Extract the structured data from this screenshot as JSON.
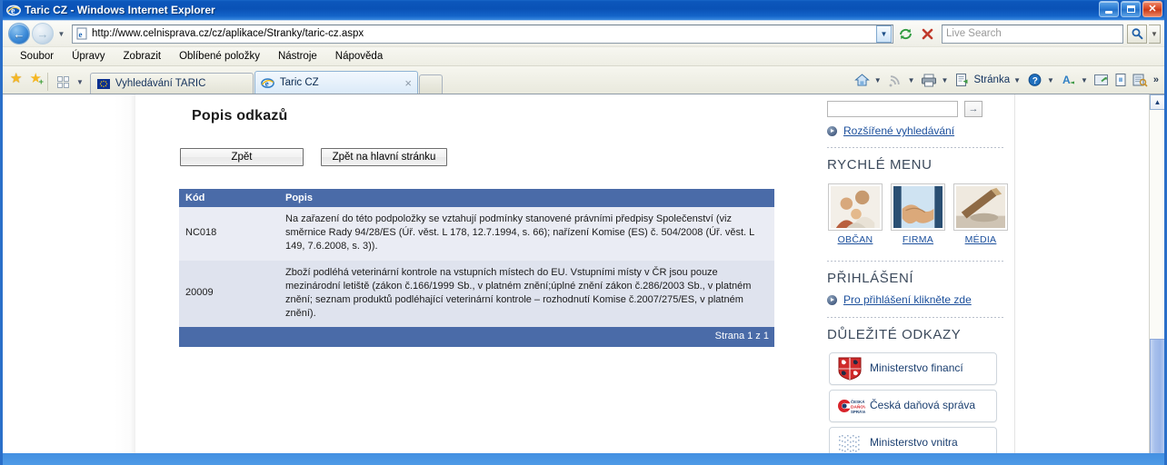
{
  "window": {
    "title": "Taric CZ - Windows Internet Explorer",
    "minimize_label": "Minimize",
    "maximize_label": "Maximize",
    "close_label": "Close"
  },
  "nav": {
    "back_label": "Back",
    "forward_label": "Forward",
    "recent_label": "Recent Pages",
    "url": "http://www.celnisprava.cz/cz/aplikace/Stranky/taric-cz.aspx",
    "url_dropdown": "Address dropdown",
    "refresh_label": "Refresh",
    "stop_label": "Stop",
    "search_placeholder": "Live Search",
    "search_go_label": "Search",
    "search_dropdown_label": "Search options"
  },
  "menubar": {
    "items": [
      {
        "label": "Soubor"
      },
      {
        "label": "Úpravy"
      },
      {
        "label": "Zobrazit"
      },
      {
        "label": "Oblíbené položky"
      },
      {
        "label": "Nástroje"
      },
      {
        "label": "Nápověda"
      }
    ]
  },
  "favbar": {
    "favorites_center_label": "Centrum oblíbených položek",
    "add_favorite_label": "Přidat k oblíbeným položkám",
    "quick_tabs_label": "Rychlé karty",
    "tab_list_label": "Seznam karet"
  },
  "tabs": [
    {
      "label": "Vyhledávání TARIC",
      "icon": "eu-flag-icon",
      "active": false,
      "closable": false
    },
    {
      "label": "Taric CZ",
      "icon": "ie-icon",
      "active": true,
      "closable": true,
      "close_label": "×"
    }
  ],
  "newtab": {
    "label": "Nová karta"
  },
  "commandbar": {
    "home_label": "Domovská stránka",
    "feeds_label": "Kanály",
    "print_label": "Tisk",
    "page_label": "Stránka",
    "help_label": "Nápověda",
    "safety_label": "Zabezpečení",
    "tools_label": "Nástroje",
    "readmail_label": "Číst poštu",
    "research_label": "Výzkum",
    "overflow_label": "»"
  },
  "main": {
    "page_title": "Popis odkazů",
    "buttons": {
      "back": "Zpět",
      "home": "Zpět na hlavní stránku"
    },
    "table": {
      "columns": [
        "Kód",
        "Popis"
      ],
      "rows": [
        {
          "kod": "NC018",
          "popis": "Na zařazení do této podpoložky se vztahují podmínky stanovené právními předpisy Společenství (viz směrnice Rady 94/28/ES (Úř. věst. L 178, 12.7.1994, s. 66); nařízení Komise (ES) č. 504/2008 (Úř. věst. L 149, 7.6.2008, s. 3))."
        },
        {
          "kod": "20009",
          "popis": "Zboží podléhá veterinární kontrole na vstupních místech do EU. Vstupními místy v ČR jsou pouze mezinárodní letiště (zákon č.166/1999 Sb., v platném znění;úplné znění zákon č.286/2003 Sb., v platném znění; seznam produktů podléhající veterinární kontrole – rozhodnutí Komise č.2007/275/ES, v platném znění)."
        }
      ],
      "footer": "Strana 1 z 1"
    }
  },
  "sidebar": {
    "search": {
      "value": "",
      "placeholder": "",
      "go_label": "→"
    },
    "advanced_search_link": "Rozšířené vyhledávání",
    "quick_menu": {
      "heading": "RYCHLÉ MENU",
      "items": [
        {
          "label": "OBČAN",
          "icon": "family-photo"
        },
        {
          "label": "FIRMA",
          "icon": "handshake-photo"
        },
        {
          "label": "MÉDIA",
          "icon": "pen-signing-photo"
        }
      ]
    },
    "login": {
      "heading": "PŘIHLÁŠENÍ",
      "link": "Pro přihlášení klikněte zde"
    },
    "important_links": {
      "heading": "DŮLEŽITÉ ODKAZY",
      "items": [
        {
          "label": "Ministerstvo financí",
          "icon": "czech-coat-of-arms-icon"
        },
        {
          "label": "Česká daňová správa",
          "icon": "ceska-danova-sprava-logo"
        },
        {
          "label": "Ministerstvo vnitra",
          "icon": "ministerstvo-vnitra-logo"
        }
      ]
    }
  },
  "scrollbar": {
    "up_label": "▲",
    "down_label": "▼"
  },
  "colors": {
    "titlebar_blue": "#0c56bb",
    "table_header_blue": "#4a6ba8",
    "row_odd": "#eaecf4",
    "row_even": "#dfe3ee",
    "link_blue": "#1b4f9c",
    "heading_gray": "#3c4a5c"
  }
}
